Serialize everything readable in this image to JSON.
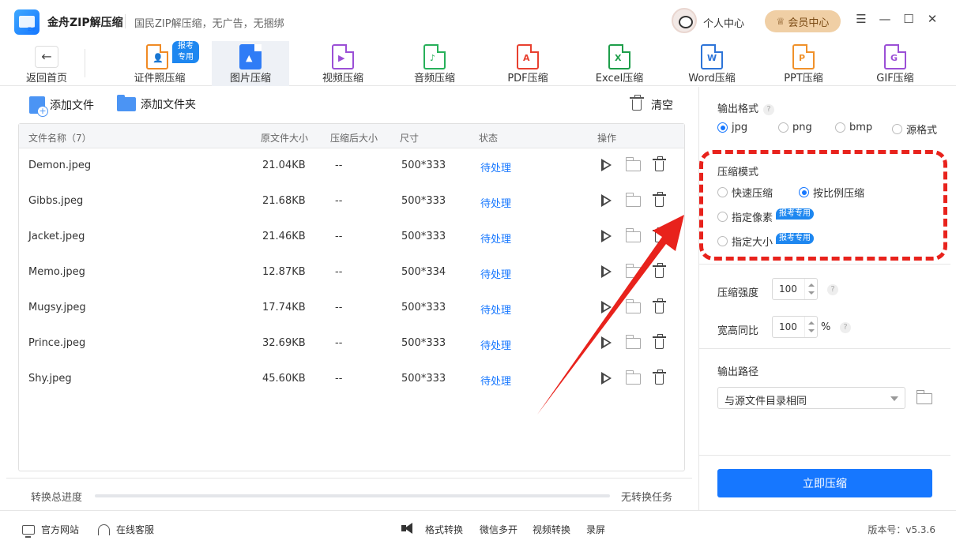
{
  "app": {
    "title": "金舟ZIP解压缩",
    "logo_text": "ZIP",
    "slogan": "国民ZIP解压缩，无广告，无捆绑",
    "user_center": "个人中心",
    "vip_label": "会员中心",
    "window_controls": [
      "☰",
      "—",
      "☐",
      "✕"
    ]
  },
  "toolbar": {
    "back_label": "返回首页",
    "tools": [
      {
        "label": "证件照压缩",
        "badge": "报考专用",
        "color": "#f08a24",
        "glyph": "👤"
      },
      {
        "label": "图片压缩",
        "badge": "",
        "color": "#2f7cf6",
        "glyph": "▲",
        "active": true
      },
      {
        "label": "视频压缩",
        "badge": "",
        "color": "#9b4fd6",
        "glyph": "▶"
      },
      {
        "label": "音频压缩",
        "badge": "",
        "color": "#27b05a",
        "glyph": "♪"
      },
      {
        "label": "PDF压缩",
        "badge": "",
        "color": "#e8402f",
        "glyph": "A"
      },
      {
        "label": "Excel压缩",
        "badge": "",
        "color": "#1e9e4a",
        "glyph": "X"
      },
      {
        "label": "Word压缩",
        "badge": "",
        "color": "#2d74d8",
        "glyph": "W"
      },
      {
        "label": "PPT压缩",
        "badge": "",
        "color": "#f0912a",
        "glyph": "P"
      },
      {
        "label": "GIF压缩",
        "badge": "",
        "color": "#9b4fd6",
        "glyph": "G"
      }
    ]
  },
  "actions": {
    "add_file": "添加文件",
    "add_folder": "添加文件夹",
    "clear": "清空"
  },
  "table": {
    "headers": {
      "name": "文件名称（7）",
      "orig_size": "原文件大小",
      "comp_size": "压缩后大小",
      "dimensions": "尺寸",
      "status": "状态",
      "ops": "操作"
    },
    "rows": [
      {
        "name": "Demon.jpeg",
        "orig_size": "21.04KB",
        "comp_size": "--",
        "dimensions": "500*333",
        "status": "待处理"
      },
      {
        "name": "Gibbs.jpeg",
        "orig_size": "21.68KB",
        "comp_size": "--",
        "dimensions": "500*333",
        "status": "待处理"
      },
      {
        "name": "Jacket.jpeg",
        "orig_size": "21.46KB",
        "comp_size": "--",
        "dimensions": "500*333",
        "status": "待处理"
      },
      {
        "name": "Memo.jpeg",
        "orig_size": "12.87KB",
        "comp_size": "--",
        "dimensions": "500*334",
        "status": "待处理"
      },
      {
        "name": "Mugsy.jpeg",
        "orig_size": "17.74KB",
        "comp_size": "--",
        "dimensions": "500*333",
        "status": "待处理"
      },
      {
        "name": "Prince.jpeg",
        "orig_size": "32.69KB",
        "comp_size": "--",
        "dimensions": "500*333",
        "status": "待处理"
      },
      {
        "name": "Shy.jpeg",
        "orig_size": "45.60KB",
        "comp_size": "--",
        "dimensions": "500*333",
        "status": "待处理"
      }
    ]
  },
  "progress": {
    "label": "转换总进度",
    "percent": 0,
    "status": "无转换任务"
  },
  "settings": {
    "output_format_label": "输出格式",
    "formats": [
      {
        "label": "jpg",
        "selected": true
      },
      {
        "label": "png",
        "selected": false
      },
      {
        "label": "bmp",
        "selected": false
      },
      {
        "label": "源格式",
        "selected": false
      }
    ],
    "mode_label": "压缩模式",
    "modes": [
      {
        "label": "快速压缩",
        "selected": false,
        "badge": ""
      },
      {
        "label": "按比例压缩",
        "selected": true,
        "badge": ""
      },
      {
        "label": "指定像素",
        "selected": false,
        "badge": "报考专用"
      },
      {
        "label": "指定大小",
        "selected": false,
        "badge": "报考专用"
      }
    ],
    "strength_label": "压缩强度",
    "strength_value": "100",
    "ratio_label": "宽高同比",
    "ratio_value": "100",
    "ratio_unit": "%",
    "help_glyph": "?",
    "output_path_label": "输出路径",
    "output_path_value": "与源文件目录相同",
    "compress_button": "立即压缩"
  },
  "footer": {
    "website": "官方网站",
    "service": "在线客服",
    "links": [
      "格式转换",
      "微信多开",
      "视频转换",
      "录屏"
    ],
    "version": "版本号：v5.3.6"
  },
  "colors": {
    "accent": "#1677ff",
    "annotation_red": "#e8221c",
    "vip_bg": "#f0cfa5"
  }
}
